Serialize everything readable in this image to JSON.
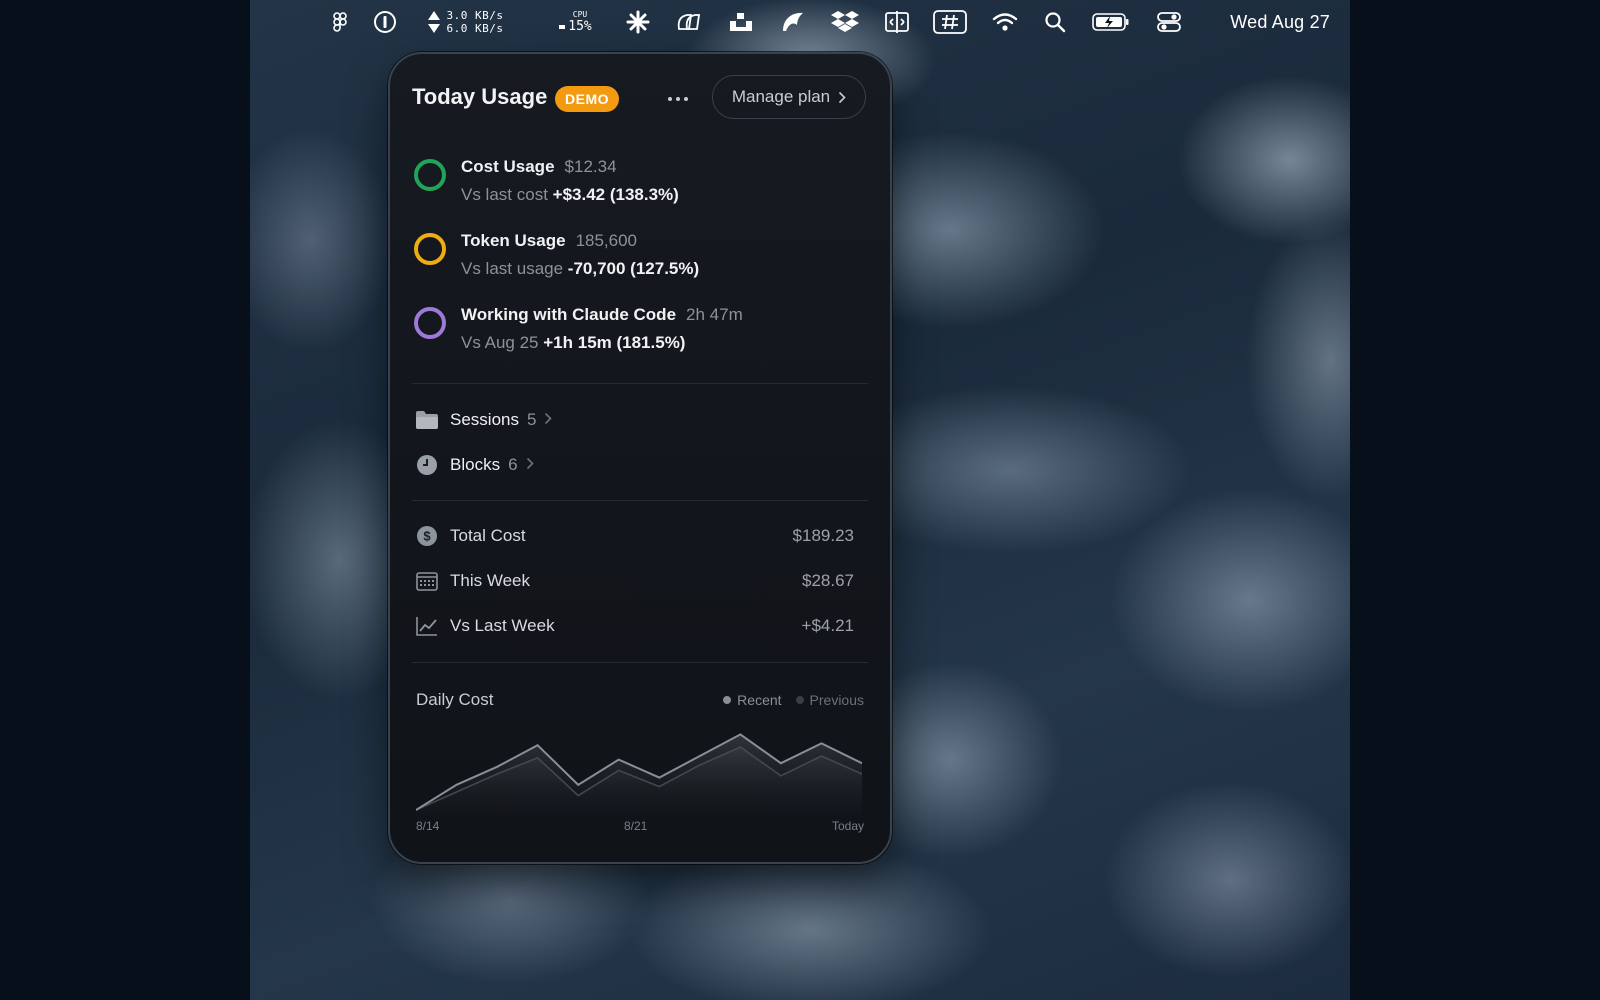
{
  "menubar": {
    "net_up": "3.0 KB/s",
    "net_down": "6.0 KB/s",
    "cpu_label": "CPU",
    "cpu_value": "15%",
    "date": "Wed Aug 27",
    "icons": [
      "figma-icon",
      "onepassword-icon",
      "network-icon",
      "cpu-icon",
      "asterisk-icon",
      "shapes-icon",
      "dock-icon",
      "bird-icon",
      "dropbox-icon",
      "window-split-icon",
      "hashtag-icon",
      "wifi-icon",
      "search-icon",
      "battery-icon",
      "control-center-icon"
    ]
  },
  "panel": {
    "title": "Today Usage",
    "badge": "DEMO",
    "manage_label": "Manage plan",
    "metrics": [
      {
        "title": "Cost Usage",
        "value": "$12.34",
        "sub_label": "Vs last cost",
        "sub_value": "+$3.42 (138.3%)",
        "color": "#22a35a"
      },
      {
        "title": "Token Usage",
        "value": "185,600",
        "sub_label": "Vs last usage",
        "sub_value": "-70,700 (127.5%)",
        "color": "#f0ad11"
      },
      {
        "title": "Working with Claude Code",
        "value": "2h 47m",
        "sub_label": "Vs Aug 25",
        "sub_value": "+1h 15m (181.5%)",
        "color": "#9e7ad8"
      }
    ],
    "nav": [
      {
        "label": "Sessions",
        "count": "5",
        "icon": "folder-icon"
      },
      {
        "label": "Blocks",
        "count": "6",
        "icon": "clock-icon"
      }
    ],
    "stats": [
      {
        "label": "Total Cost",
        "value": "$189.23",
        "icon": "dollar-icon"
      },
      {
        "label": "This Week",
        "value": "$28.67",
        "icon": "calendar-icon"
      },
      {
        "label": "Vs Last Week",
        "value": "+$4.21",
        "icon": "trend-icon"
      }
    ]
  },
  "chart_data": {
    "type": "area",
    "title": "Daily Cost",
    "series": [
      {
        "name": "Recent",
        "values": [
          0.0,
          1.4,
          2.4,
          3.6,
          1.4,
          2.8,
          1.8,
          3.0,
          4.2,
          2.6,
          3.7,
          2.6
        ],
        "color": "#8a8f97"
      },
      {
        "name": "Previous",
        "values": [
          0.0,
          1.0,
          2.0,
          2.9,
          0.8,
          2.2,
          1.3,
          2.5,
          3.5,
          1.9,
          3.0,
          2.0
        ],
        "color": "#4a4f57"
      }
    ],
    "x_ticks": [
      "8/14",
      "8/21",
      "Today"
    ],
    "ylim": [
      0,
      5
    ],
    "grid": false,
    "legend": "top-right"
  }
}
